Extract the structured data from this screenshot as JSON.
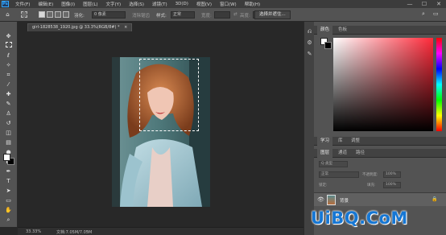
{
  "app": {
    "logo_text": "Ps",
    "brand_color": "#31a8ff"
  },
  "menu": [
    "文件(F)",
    "编辑(E)",
    "图像(I)",
    "图层(L)",
    "文字(Y)",
    "选择(S)",
    "滤镜(T)",
    "3D(D)",
    "视图(V)",
    "窗口(W)",
    "帮助(H)"
  ],
  "window_controls": {
    "minimize": "—",
    "maximize": "☐",
    "close": "✕"
  },
  "options": {
    "feather_label": "羽化:",
    "feather_value": "0 像素",
    "antialias_label": "消除锯齿",
    "style_label": "样式:",
    "style_value": "正常",
    "width_label": "宽度:",
    "height_label": "高度:",
    "select_mask_button": "选择并遮住..."
  },
  "document": {
    "tab_title": "girl-1828538_1920.jpg @ 33.3%(RGB/8#) *",
    "tab_close": "×"
  },
  "status": {
    "zoom": "33.33%",
    "doc_info": "文档:7.05M/7.05M"
  },
  "color_panel": {
    "tabs": [
      "颜色",
      "色板"
    ]
  },
  "learn_panel": {
    "tabs": [
      "学习",
      "库",
      "调整"
    ]
  },
  "layers_panel": {
    "tabs": [
      "图层",
      "通道",
      "路径"
    ],
    "kind_placeholder": "Q 类型",
    "blend_mode": "正常",
    "opacity_label": "不透明度:",
    "opacity_value": "100%",
    "lock_label": "锁定:",
    "fill_label": "填充:",
    "fill_value": "100%",
    "layer_name": "背景"
  },
  "watermark": "UiBQ.CoM",
  "colors": {
    "foreground": "#ffffff",
    "background": "#000000",
    "hue_selected": "#ff2a3a"
  }
}
